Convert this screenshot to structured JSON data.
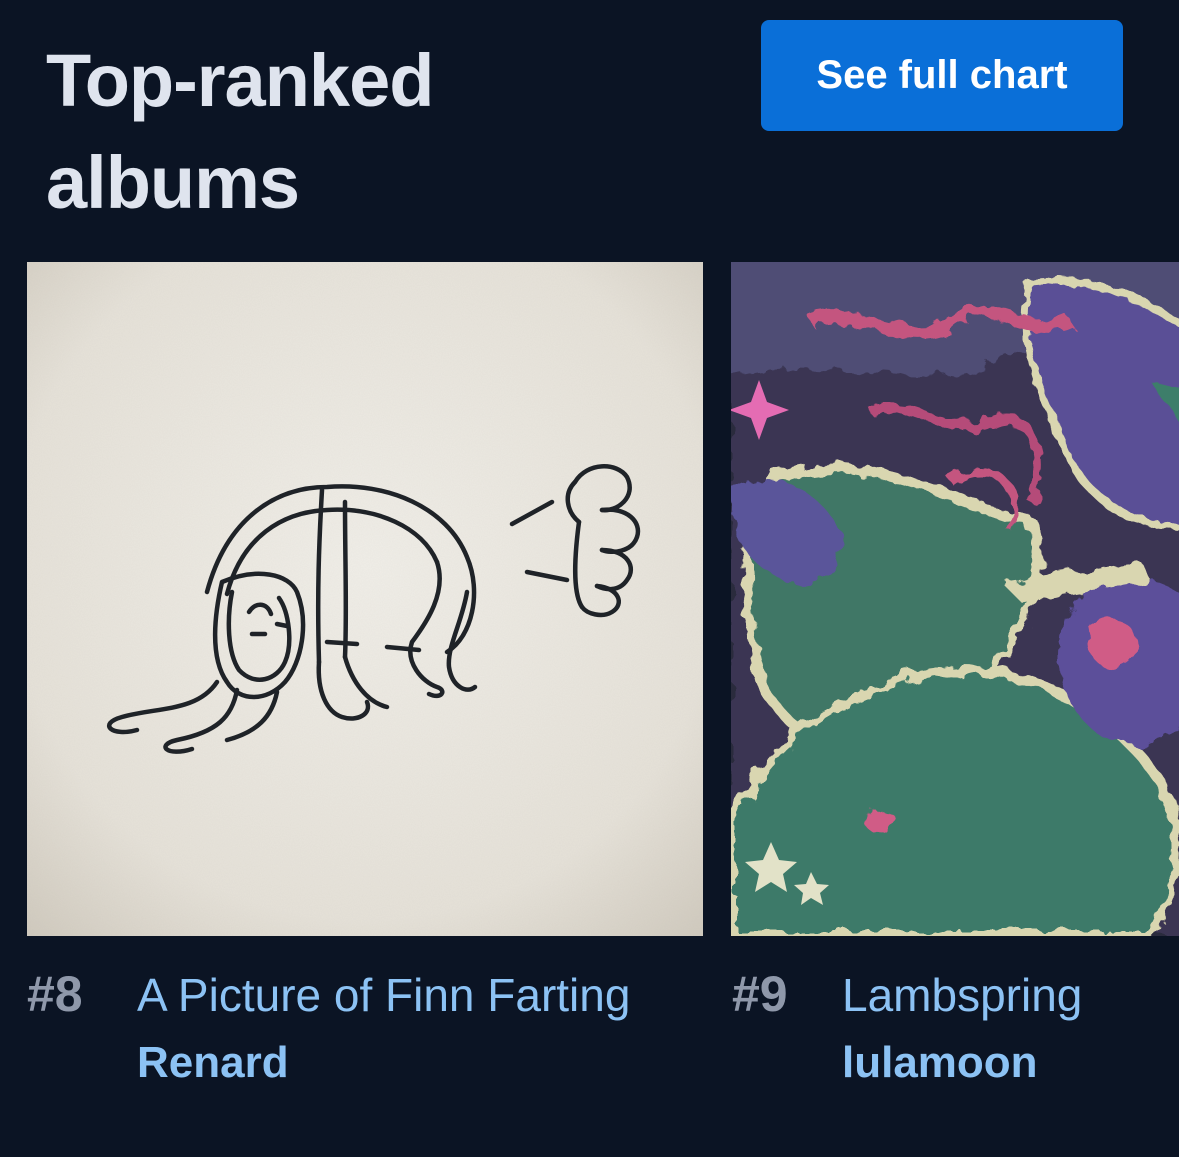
{
  "section": {
    "title": "Top-ranked albums",
    "button_label": "See full chart"
  },
  "albums": [
    {
      "rank": "#8",
      "title": "A Picture of Finn Farting",
      "artist": "Renard"
    },
    {
      "rank": "#9",
      "title": "Lambspring",
      "artist": "lulamoon"
    }
  ],
  "colors": {
    "background": "#0b1424",
    "button": "#0a6fd8",
    "link": "#8cc2f4",
    "rank": "#8f98aa",
    "heading": "#dfe4ee"
  }
}
